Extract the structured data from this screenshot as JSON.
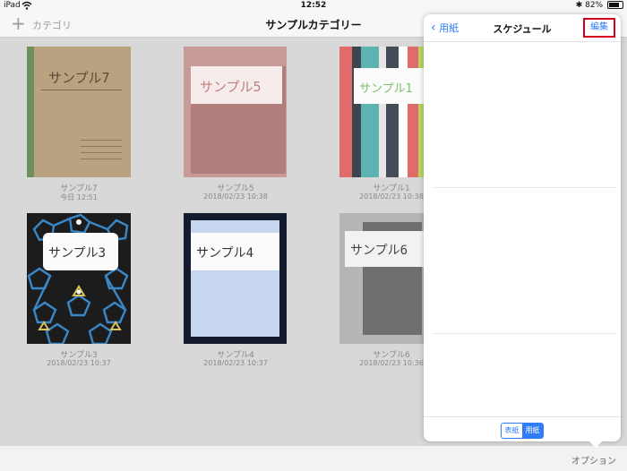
{
  "status": {
    "device": "iPad",
    "time": "12:52",
    "battery_text": "82%",
    "battery_level": 0.82
  },
  "nav": {
    "add_label": "カテゴリ",
    "title": "サンプルカテゴリー"
  },
  "notebooks": [
    {
      "name": "サンプル7",
      "date": "今日 12:51",
      "label": "サンプル7"
    },
    {
      "name": "サンプル5",
      "date": "2018/02/23 10:38",
      "label": "サンプル5"
    },
    {
      "name": "サンプル1",
      "date": "2018/02/23 10:38",
      "label": "サンプル1"
    },
    {
      "name": "サンプル3",
      "date": "2018/02/23 10:37",
      "label": "サンプル3"
    },
    {
      "name": "サンプル4",
      "date": "2018/02/23 10:37",
      "label": "サンプル4"
    },
    {
      "name": "サンプル6",
      "date": "2018/02/23 10:36",
      "label": "サンプル6"
    }
  ],
  "popover": {
    "back_label": "用紙",
    "title": "スケジュール",
    "edit_label": "編集",
    "segments": [
      "表紙",
      "用紙"
    ],
    "selected_segment": "用紙"
  },
  "bottom": {
    "options_label": "オプション"
  },
  "colors": {
    "accent": "#2f7cf6",
    "highlight_border": "#d0021b"
  }
}
